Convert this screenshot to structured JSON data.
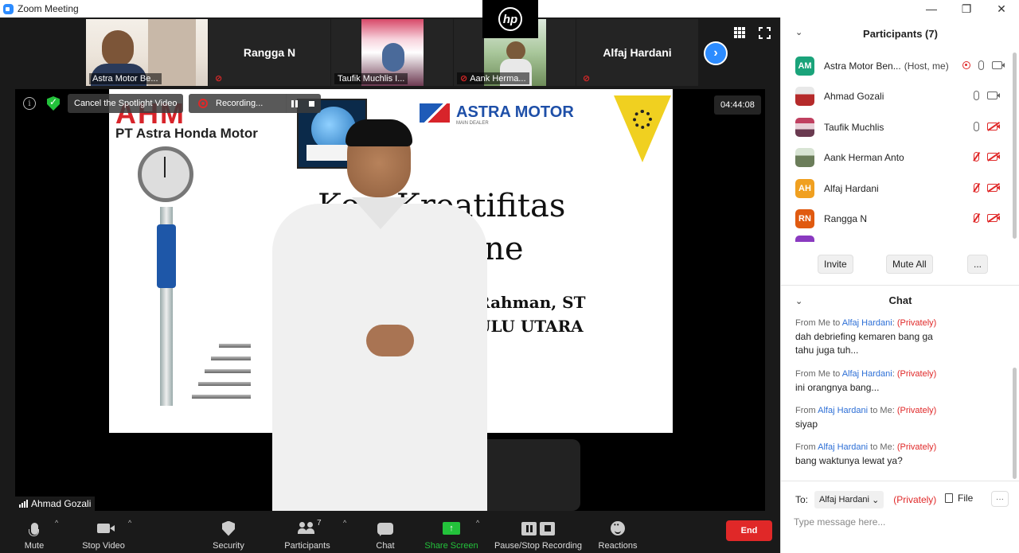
{
  "window": {
    "title": "Zoom Meeting",
    "controls": [
      "—",
      "❐",
      "✕"
    ]
  },
  "strip": {
    "tiles": [
      {
        "label": "Astra Motor Be...",
        "type": "video",
        "muted": false
      },
      {
        "label": "Rangga N",
        "type": "name",
        "muted": true
      },
      {
        "label": "Taufik Muchlis I...",
        "type": "video",
        "muted": false
      },
      {
        "label": "Aank Herma...",
        "type": "video",
        "muted": true
      },
      {
        "label": "Alfaj Hardani",
        "type": "name",
        "muted": true
      }
    ],
    "next_label": "›",
    "hp_text": "hp"
  },
  "stage": {
    "spotlight_label": "Cancel the Spotlight Video",
    "recording_label": "Recording...",
    "timer": "04:44:08",
    "active_speaker": "Ahmad Gozali",
    "slide": {
      "brand": "AHM",
      "company": "PT Astra Honda Motor",
      "astra_name": "ASTRA MOTOR",
      "astra_sub": "MAIN DEALER",
      "line1": "Ko      s Kreatifitas",
      "line2": "P            iaran online",
      "line3": "Rahman, ST",
      "line4": "ULU UTARA"
    }
  },
  "toolbar": {
    "mute": "Mute",
    "stop_video": "Stop Video",
    "security": "Security",
    "participants": "Participants",
    "participants_count": "7",
    "chat": "Chat",
    "share_screen": "Share Screen",
    "record": "Pause/Stop Recording",
    "reactions": "Reactions",
    "end": "End",
    "caret": "^",
    "share_arrow": "↑"
  },
  "colors": {
    "accent": "#2d8cff",
    "share_green": "#23c23b",
    "danger": "#e02828",
    "private_red": "#e02828",
    "link_blue": "#2d6fd6"
  },
  "participants_panel": {
    "title": "Participants (7)",
    "chevron": "⌄",
    "items": [
      {
        "initials": "AM",
        "name": "Astra Motor Ben...",
        "role": "(Host, me)",
        "avatar_color": "#1aa37a",
        "recording": true,
        "mic_off": false,
        "cam_off": false
      },
      {
        "initials": "",
        "name": "Ahmad Gozali",
        "role": "",
        "avatar_color": "#b52a2a",
        "recording": false,
        "mic_off": false,
        "cam_off": false
      },
      {
        "initials": "",
        "name": "Taufik Muchlis",
        "role": "",
        "avatar_color": "#7a4a5a",
        "recording": false,
        "mic_off": false,
        "cam_off": true
      },
      {
        "initials": "",
        "name": "Aank Herman Anto",
        "role": "",
        "avatar_color": "#6b7d5a",
        "recording": false,
        "mic_off": true,
        "cam_off": true
      },
      {
        "initials": "AH",
        "name": "Alfaj Hardani",
        "role": "",
        "avatar_color": "#f0a020",
        "recording": false,
        "mic_off": true,
        "cam_off": true
      },
      {
        "initials": "RN",
        "name": "Rangga N",
        "role": "",
        "avatar_color": "#e05a10",
        "recording": false,
        "mic_off": true,
        "cam_off": true
      }
    ],
    "invite": "Invite",
    "mute_all": "Mute All",
    "more": "..."
  },
  "chat": {
    "title": "Chat",
    "messages": [
      {
        "from": "Me",
        "to": "Alfaj Hardani",
        "direction": "out",
        "private": "(Privately)",
        "text": "dah debriefing kemaren bang ga tahu juga tuh..."
      },
      {
        "from": "Me",
        "to": "Alfaj Hardani",
        "direction": "out",
        "private": "(Privately)",
        "text": "ini orangnya bang..."
      },
      {
        "from": "Alfaj Hardani",
        "to": "Me",
        "direction": "in",
        "private": "(Privately)",
        "text": "siyap"
      },
      {
        "from": "Alfaj Hardani",
        "to": "Me",
        "direction": "in",
        "private": "(Privately)",
        "text": "bang waktunya lewat ya?"
      }
    ],
    "labels": {
      "from": "From",
      "to": "to",
      "colon": ":"
    },
    "to_label": "To:",
    "to_value": "Alfaj Hardani",
    "to_private": "(Privately)",
    "file": "File",
    "more": "···",
    "placeholder": "Type message here..."
  }
}
